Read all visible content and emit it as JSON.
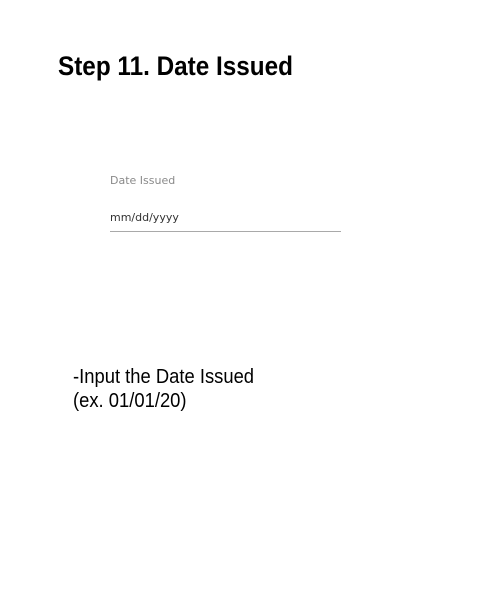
{
  "step": {
    "title": "Step 11. Date Issued"
  },
  "form": {
    "date_issued": {
      "label": "Date Issued",
      "placeholder": "mm/dd/yyyy",
      "value": ""
    }
  },
  "instructions": {
    "line1": "-Input the Date Issued",
    "line2": "(ex. 01/01/20)"
  }
}
